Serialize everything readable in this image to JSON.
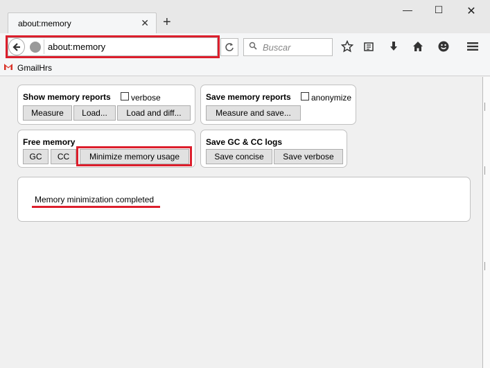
{
  "tab": {
    "title": "about:memory",
    "close": "✕",
    "new_tab": "+"
  },
  "window_controls": {
    "minimize": "—",
    "maximize": "☐",
    "close": "✕"
  },
  "navbar": {
    "url": "about:memory",
    "search_placeholder": "Buscar",
    "icons": [
      "back-icon",
      "globe-icon",
      "reload-icon",
      "search-icon",
      "star-icon",
      "reading-list-icon",
      "download-icon",
      "home-icon",
      "smiley-icon",
      "hamburger-menu-icon"
    ]
  },
  "bookmarks": {
    "items": [
      {
        "icon": "gmail-icon",
        "label": "GmailHrs"
      }
    ]
  },
  "show_reports": {
    "label": "Show memory reports",
    "verbose_label": "verbose",
    "verbose_checked": false,
    "buttons": [
      "Measure",
      "Load...",
      "Load and diff..."
    ]
  },
  "save_reports": {
    "label": "Save memory reports",
    "anonymize_label": "anonymize",
    "anonymize_checked": false,
    "buttons": [
      "Measure and save..."
    ]
  },
  "free_memory": {
    "label": "Free memory",
    "buttons": [
      "GC",
      "CC",
      "Minimize memory usage"
    ]
  },
  "save_logs": {
    "label": "Save GC & CC logs",
    "buttons": [
      "Save concise",
      "Save verbose"
    ]
  },
  "status": {
    "message": "Memory minimization completed"
  },
  "colors": {
    "highlight": "#dc1e2c",
    "button_bg": "#e1e1e1"
  }
}
